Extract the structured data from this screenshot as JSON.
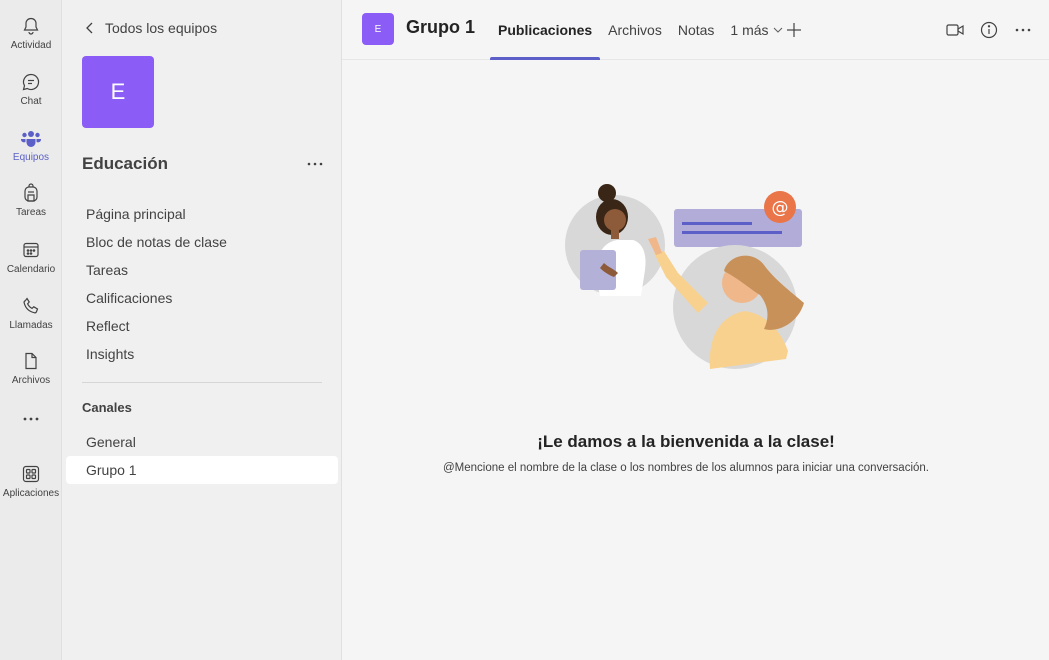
{
  "rail": {
    "items": [
      {
        "label": "Actividad",
        "icon": "bell-icon"
      },
      {
        "label": "Chat",
        "icon": "chat-icon"
      },
      {
        "label": "Equipos",
        "icon": "teams-icon"
      },
      {
        "label": "Tareas",
        "icon": "backpack-icon"
      },
      {
        "label": "Calendario",
        "icon": "calendar-icon"
      },
      {
        "label": "Llamadas",
        "icon": "phone-icon"
      },
      {
        "label": "Archivos",
        "icon": "file-icon"
      },
      {
        "label": "Aplicaciones",
        "icon": "apps-icon"
      }
    ],
    "active": "Equipos",
    "more_label": "···"
  },
  "sidebar": {
    "back_label": "Todos los equipos",
    "team_initial": "E",
    "team_name": "Educación",
    "more_label": "···",
    "nav_items": [
      "Página principal",
      "Bloc de notas de clase",
      "Tareas",
      "Calificaciones",
      "Reflect",
      "Insights"
    ],
    "channels_title": "Canales",
    "channels": [
      "General",
      "Grupo 1"
    ],
    "active_channel": "Grupo 1"
  },
  "header": {
    "channel_initial": "E",
    "channel_title": "Grupo 1",
    "tabs": [
      "Publicaciones",
      "Archivos",
      "Notas",
      "1 más"
    ],
    "active_tab": "Publicaciones",
    "more_label": "···"
  },
  "main": {
    "welcome_title": "¡Le damos a la bienvenida a la clase!",
    "welcome_subtitle": "@Mencione el nombre de la clase o los nombres de los alumnos para iniciar una conversación."
  },
  "colors": {
    "accent": "#5b5fc7",
    "team_avatar": "#8b5cf6"
  }
}
